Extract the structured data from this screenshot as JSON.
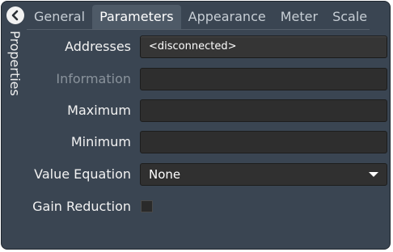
{
  "sidebar": {
    "back_icon": "chevron-left-icon",
    "title": "Properties"
  },
  "tabs": [
    {
      "label": "General",
      "active": false
    },
    {
      "label": "Parameters",
      "active": true
    },
    {
      "label": "Appearance",
      "active": false
    },
    {
      "label": "Meter",
      "active": false
    },
    {
      "label": "Scale",
      "active": false
    }
  ],
  "form": {
    "addresses": {
      "label": "Addresses",
      "value": "<disconnected>"
    },
    "information": {
      "label": "Information",
      "value": "",
      "disabled": true
    },
    "maximum": {
      "label": "Maximum",
      "value": ""
    },
    "minimum": {
      "label": "Minimum",
      "value": ""
    },
    "value_equation": {
      "label": "Value Equation",
      "selected": "None"
    },
    "gain_reduction": {
      "label": "Gain Reduction",
      "checked": false
    }
  },
  "colors": {
    "panel": "#3a4552",
    "active_tab": "#4e5a67",
    "field": "#2e2e2e",
    "text": "#f2f2f2",
    "disabled_text": "#8a939c"
  }
}
